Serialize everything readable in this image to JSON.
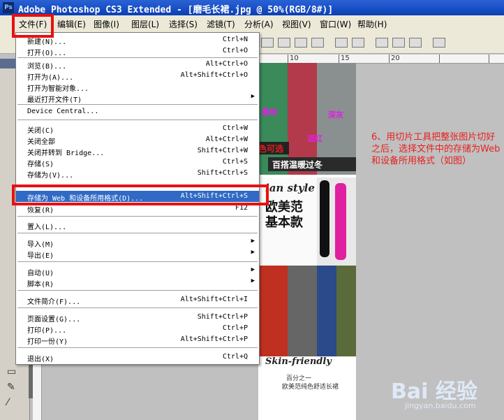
{
  "window": {
    "title": "Adobe Photoshop CS3 Extended - [磨毛长裙.jpg @ 50%(RGB/8#)]",
    "app_icon": "Ps"
  },
  "menubar": {
    "items": [
      "文件(F)",
      "编辑(E)",
      "图像(I)",
      "图层(L)",
      "选择(S)",
      "滤镜(T)",
      "分析(A)",
      "视图(V)",
      "窗口(W)",
      "帮助(H)"
    ]
  },
  "ruler": {
    "ticks": [
      "10",
      "15",
      "20"
    ]
  },
  "file_menu": {
    "items": [
      {
        "label": "新建(N)...",
        "shortcut": "Ctrl+N"
      },
      {
        "label": "打开(O)...",
        "shortcut": "Ctrl+O"
      },
      {
        "label": "浏览(B)...",
        "shortcut": "Alt+Ctrl+O"
      },
      {
        "label": "打开为(A)...",
        "shortcut": "Alt+Shift+Ctrl+O"
      },
      {
        "label": "打开为智能对象...",
        "shortcut": ""
      },
      {
        "label": "最近打开文件(T)",
        "shortcut": "",
        "submenu": true
      },
      {
        "label": "Device Central...",
        "shortcut": ""
      },
      {
        "label": "关闭(C)",
        "shortcut": "Ctrl+W"
      },
      {
        "label": "关闭全部",
        "shortcut": "Alt+Ctrl+W"
      },
      {
        "label": "关闭并转到 Bridge...",
        "shortcut": "Shift+Ctrl+W"
      },
      {
        "label": "存储(S)",
        "shortcut": "Ctrl+S"
      },
      {
        "label": "存储为(V)...",
        "shortcut": "Shift+Ctrl+S"
      },
      {
        "label": "存储为 Web 和设备所用格式(D)...",
        "shortcut": "Alt+Shift+Ctrl+S",
        "highlighted": true
      },
      {
        "label": "恢复(R)",
        "shortcut": "F12"
      },
      {
        "label": "置入(L)...",
        "shortcut": ""
      },
      {
        "label": "导入(M)",
        "shortcut": "",
        "submenu": true
      },
      {
        "label": "导出(E)",
        "shortcut": "",
        "submenu": true
      },
      {
        "label": "自动(U)",
        "shortcut": "",
        "submenu": true
      },
      {
        "label": "脚本(R)",
        "shortcut": "",
        "submenu": true
      },
      {
        "label": "文件简介(F)...",
        "shortcut": "Alt+Shift+Ctrl+I"
      },
      {
        "label": "页面设置(G)...",
        "shortcut": "Shift+Ctrl+P"
      },
      {
        "label": "打印(P)...",
        "shortcut": "Ctrl+P"
      },
      {
        "label": "打印一份(Y)",
        "shortcut": "Alt+Shift+Ctrl+P"
      },
      {
        "label": "退出(X)",
        "shortcut": "Ctrl+Q"
      }
    ]
  },
  "canvas": {
    "texts": [
      "墨绿",
      "深灰",
      "酒红",
      "色可选",
      "百搭温暖过冬",
      "ian style",
      "欧美范",
      "基本款",
      "Skin-friendly",
      "百分之一",
      "欧美范纯色舒适长裙"
    ]
  },
  "annotation": "6、用切片工具把整张图片切好之后，选择文件中的存储为Web和设备所用格式（如图）",
  "watermark": {
    "logo": "Bai 经验",
    "url": "jingyan.baidu.com"
  },
  "colors": {
    "annotation": "#e82020",
    "highlight": "#316ac5",
    "redbox": "#e81010"
  }
}
